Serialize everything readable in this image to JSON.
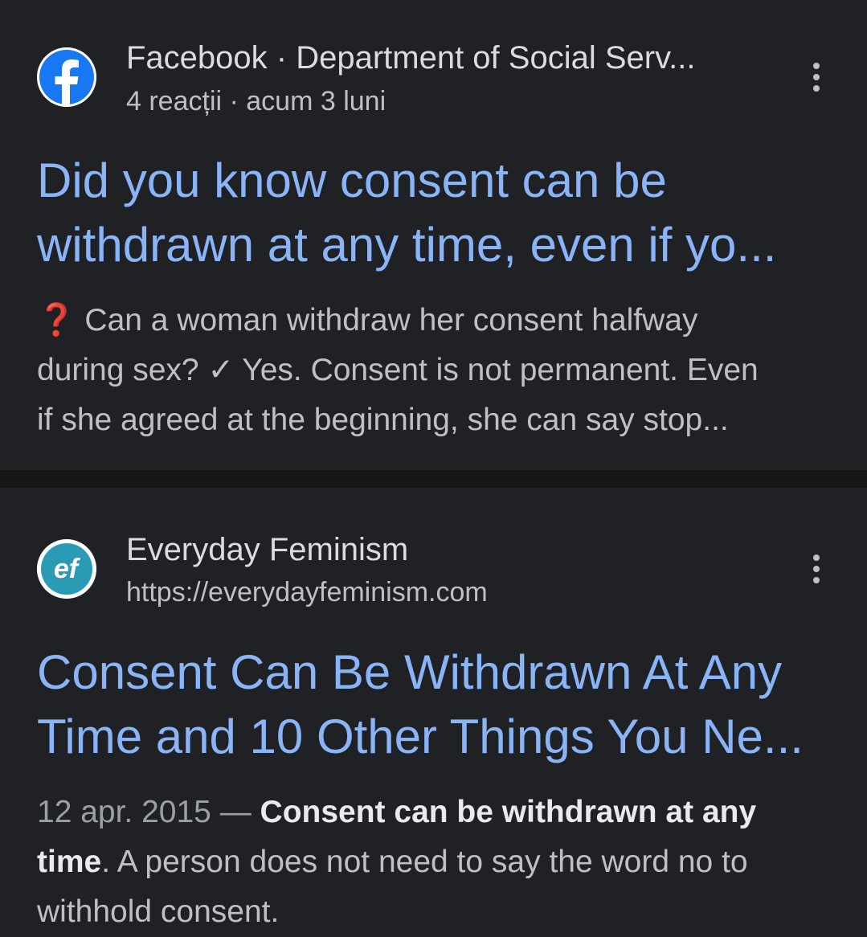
{
  "results": [
    {
      "source_name": "Facebook · Department of Social Serv...",
      "source_sub": "4 reacții · acum 3 luni",
      "icon": "facebook-icon",
      "title_lines": [
        "Did you know consent can be",
        "withdrawn at any time, even if yo..."
      ],
      "snippet": {
        "emoji": "❓",
        "line1": " Can a woman withdraw her consent halfway",
        "line2": "during sex? ✓ Yes. Consent is not permanent. Even",
        "line3": "if she agreed at the beginning, she can say stop..."
      }
    },
    {
      "source_name": "Everyday Feminism",
      "source_sub": "https://everydayfeminism.com",
      "icon": "everyday-feminism-icon",
      "title_lines": [
        "Consent Can Be Withdrawn At Any",
        "Time and 10 Other Things You Ne..."
      ],
      "snippet": {
        "date": "12 apr. 2015 — ",
        "bold1": "Consent can be withdrawn at any",
        "bold2": "time",
        "line2_rest": ". A person does not need to say the word no to",
        "line3": "withhold consent."
      }
    }
  ],
  "colors": {
    "background": "#202124",
    "separator": "#171717",
    "title": "#8ab4f8",
    "text": "#bdc1c6",
    "facebook_blue": "#1877f2",
    "everyday_feminism_teal": "#2a9bb5"
  }
}
